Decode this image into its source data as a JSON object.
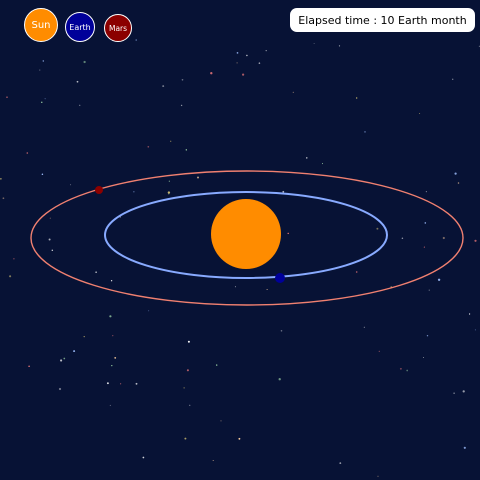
{
  "legend": {
    "sun_label": "Sun",
    "earth_label": "Earth",
    "mars_label": "Mars"
  },
  "status": {
    "elapsed_text": "Elapsed time : 10 Earth month"
  },
  "colors": {
    "background": "#071235",
    "sun": "#ff8c00",
    "earth": "#000099",
    "mars": "#8b0000",
    "earth_orbit": "#88aaff",
    "mars_orbit": "#f08070"
  }
}
